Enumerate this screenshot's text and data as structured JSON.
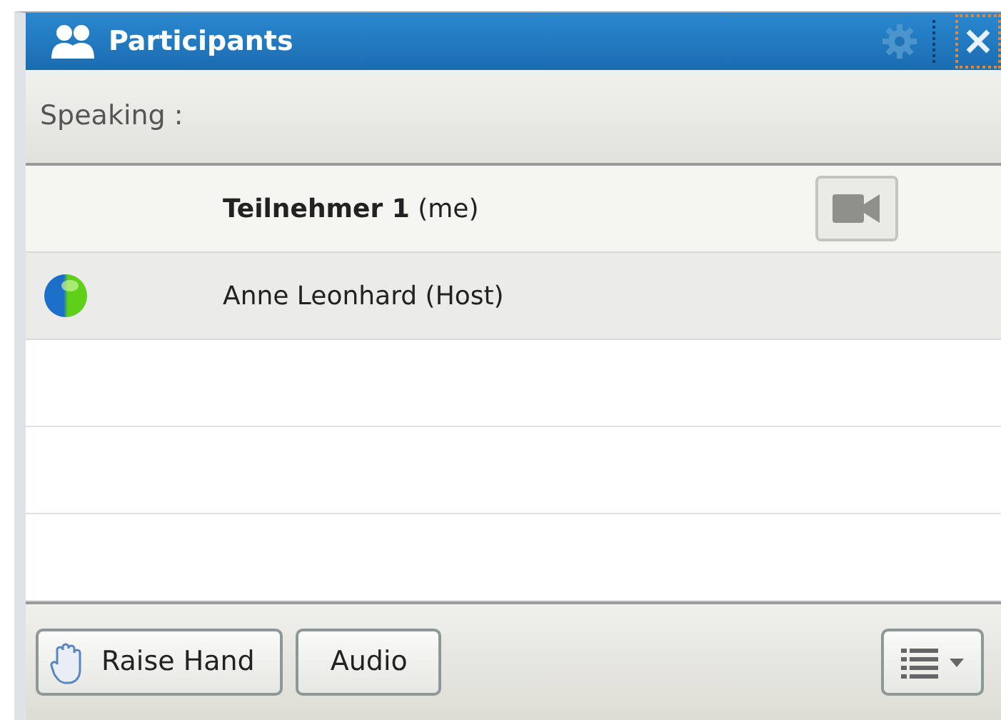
{
  "panel": {
    "title": "Participants"
  },
  "speaking": {
    "label": "Speaking :"
  },
  "participants": [
    {
      "name": "**Teilnehmer 1** (me)",
      "web_client": false,
      "video": true
    },
    {
      "name": "Anne Leonhard (Host)",
      "web_client": true,
      "video": false
    }
  ],
  "footer": {
    "buttons": [
      {
        "kind": "hand",
        "label": "Raise Hand"
      },
      {
        "kind": "plain",
        "label": "Audio"
      }
    ]
  }
}
